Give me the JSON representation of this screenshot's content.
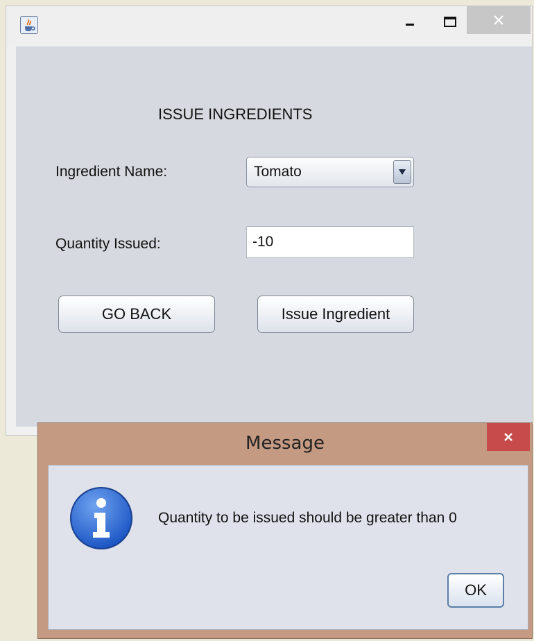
{
  "main_window": {
    "title_icon": "java-cup-icon",
    "panel_title": "ISSUE INGREDIENTS",
    "ingredient_label": "Ingredient Name:",
    "ingredient_value": "Tomato",
    "quantity_label": "Quantity Issued:",
    "quantity_value": "-10",
    "go_back_label": "GO BACK",
    "issue_label": "Issue Ingredient"
  },
  "dialog": {
    "title": "Message",
    "message": "Quantity to be issued should be greater than 0",
    "ok_label": "OK",
    "icon": "information-icon"
  },
  "colors": {
    "dialog_frame": "#c49a83",
    "dialog_close": "#c84b4b",
    "panel_bg": "#d6d9df"
  }
}
